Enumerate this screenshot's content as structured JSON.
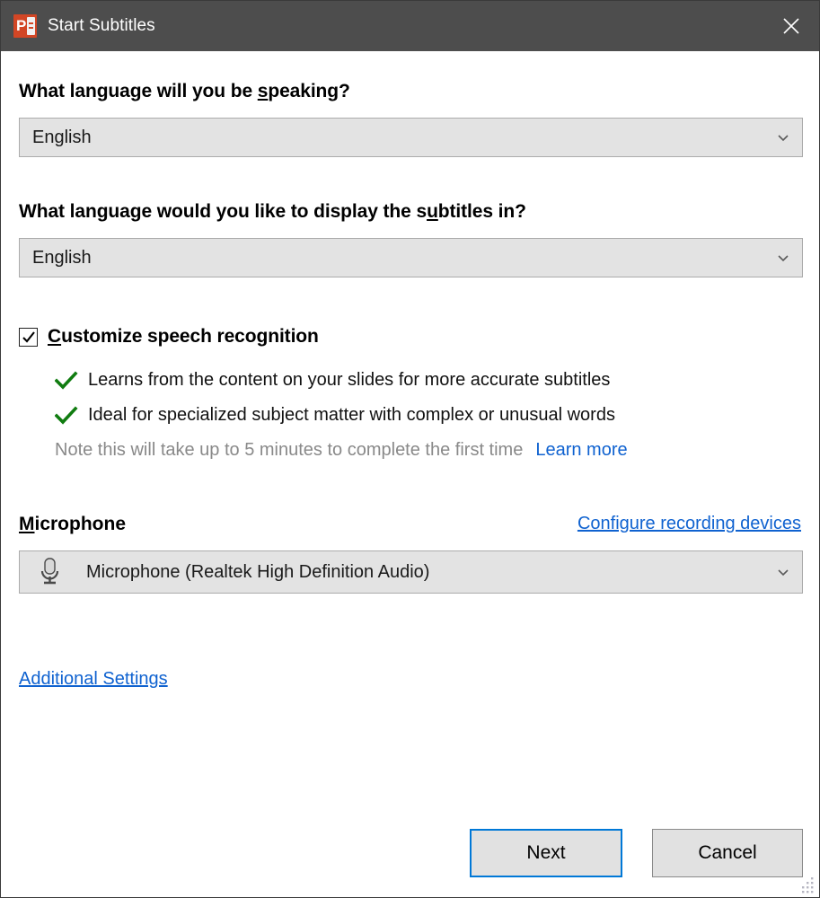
{
  "window": {
    "title": "Start Subtitles",
    "app_icon": "powerpoint-icon",
    "close_label": "✕",
    "accent_color": "#0078d7",
    "titlebar_color": "#4d4d4d",
    "link_color": "#0f62d0",
    "check_color": "#107c10"
  },
  "speaking_language": {
    "question_pre": "What language will you be ",
    "question_accel": "s",
    "question_post": "peaking?",
    "value": "English",
    "chevron": "chevron-down-icon"
  },
  "subtitle_language": {
    "question_pre": "What language would you like to display the s",
    "question_accel": "u",
    "question_post": "btitles in?",
    "value": "English",
    "chevron": "chevron-down-icon"
  },
  "customize": {
    "checked": true,
    "label_accel": "C",
    "label_post": "ustomize speech recognition",
    "benefits": [
      "Learns from the content on your slides for more accurate subtitles",
      "Ideal for specialized subject matter with complex or unusual words"
    ],
    "note": "Note this will take up to 5 minutes to complete the first time",
    "learn_more": "Learn more"
  },
  "microphone": {
    "heading_accel": "M",
    "heading_post": "icrophone",
    "configure_accel": "C",
    "configure_post": "onfigure recording devices",
    "value": "Microphone (Realtek High Definition Audio)",
    "icon": "microphone-icon",
    "chevron": "chevron-down-icon"
  },
  "additional_settings": {
    "accel": "A",
    "post": "dditional Settings"
  },
  "footer": {
    "next_label": "Next",
    "cancel_label": "Cancel",
    "grip": "resize-grip-icon"
  }
}
